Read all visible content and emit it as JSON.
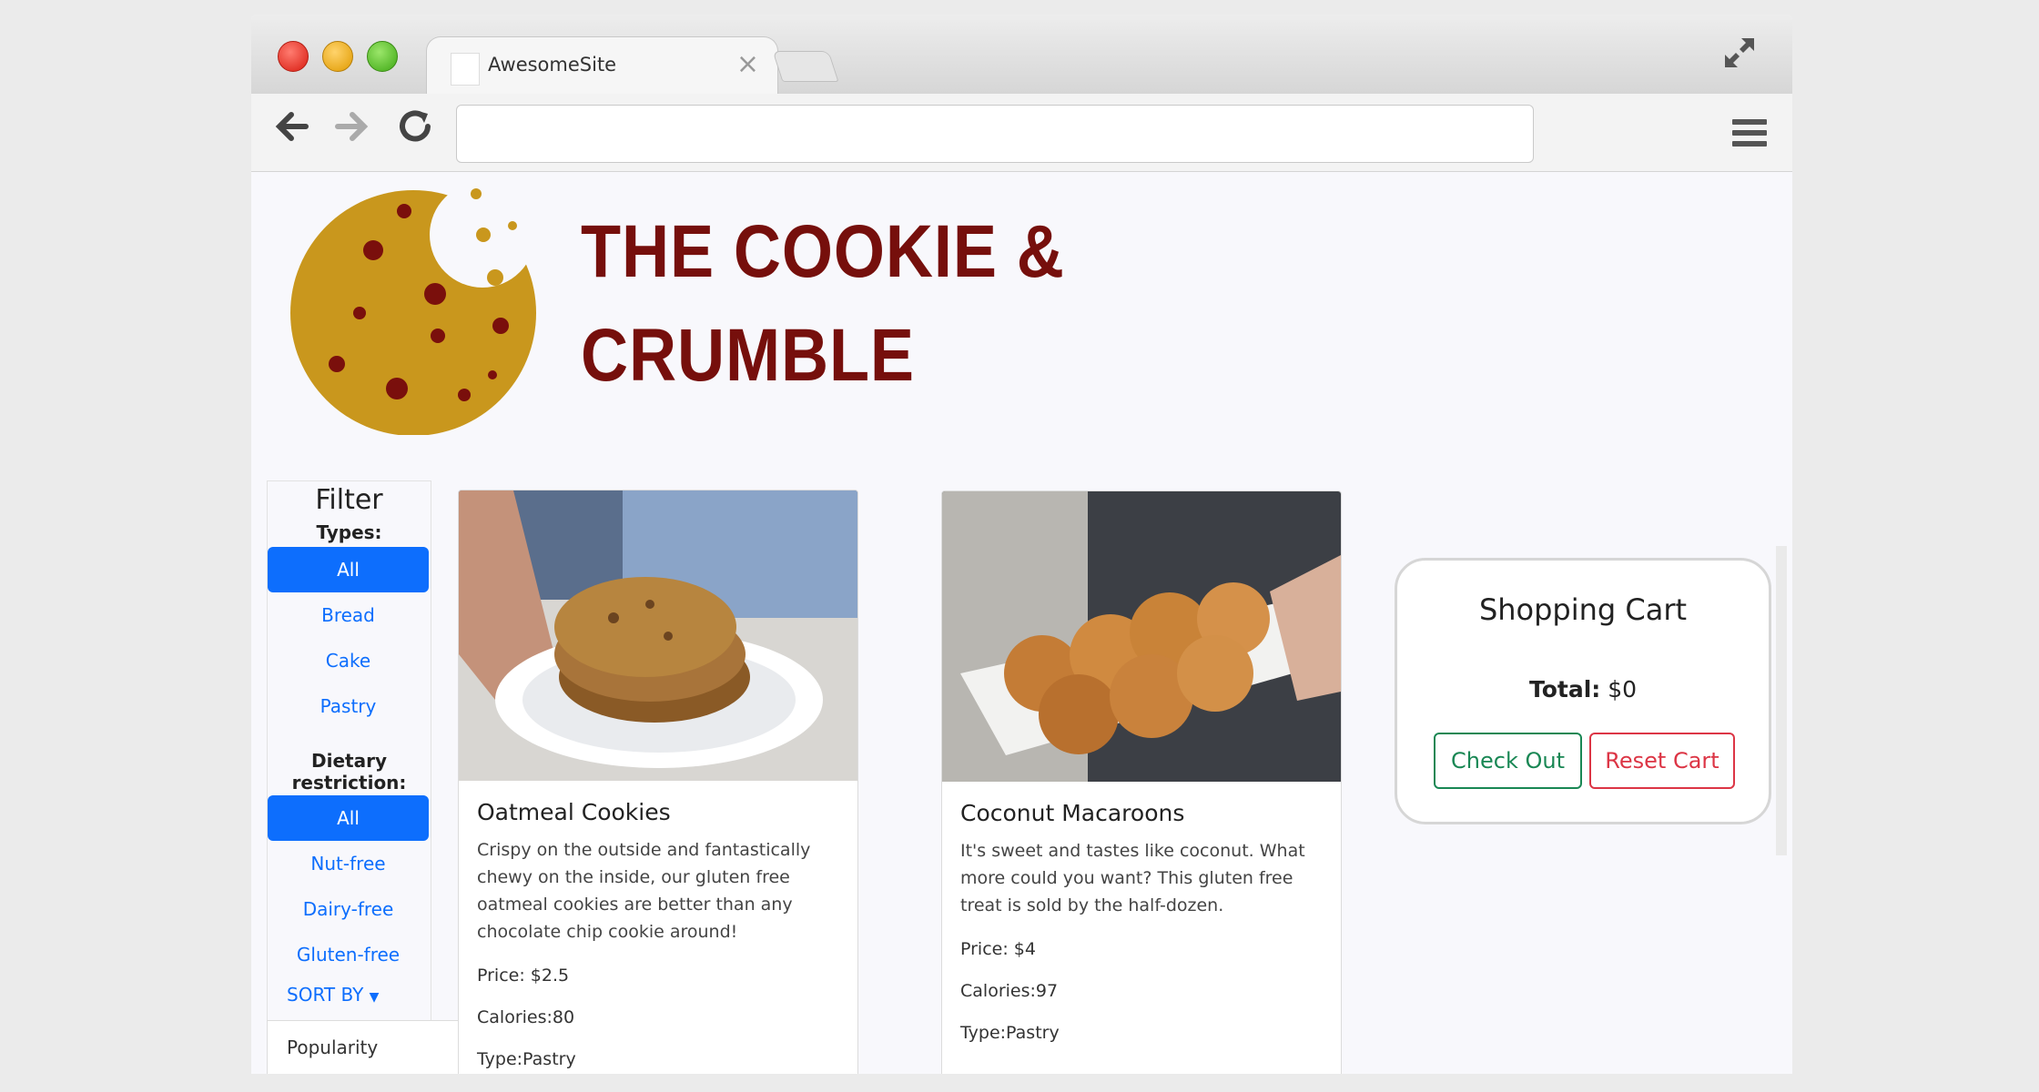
{
  "browser": {
    "tab_title": "AwesomeSite",
    "tab_close": "×",
    "url": ""
  },
  "brand": {
    "line1": "THE COOKIE &",
    "line2": "CRUMBLE"
  },
  "filter": {
    "title": "Filter",
    "types_label": "Types:",
    "types": [
      "All",
      "Bread",
      "Cake",
      "Pastry"
    ],
    "types_selected": "All",
    "dietary_label": "Dietary restriction:",
    "dietary": [
      "All",
      "Nut-free",
      "Dairy-free",
      "Gluten-free"
    ],
    "dietary_selected": "All",
    "sort_label": "SORT BY",
    "sort_option": "Popularity"
  },
  "products": [
    {
      "name": "Oatmeal Cookies",
      "description": "Crispy on the outside and fantastically chewy on the inside, our gluten free oatmeal cookies are better than any chocolate chip cookie around!",
      "price": "Price: $2.5",
      "calories": "Calories:80",
      "type": "Type:Pastry"
    },
    {
      "name": "Coconut Macaroons",
      "description": "It's sweet and tastes like coconut. What more could you want? This gluten free treat is sold by the half-dozen.",
      "price": "Price: $4",
      "calories": "Calories:97",
      "type": "Type:Pastry"
    }
  ],
  "cart": {
    "title": "Shopping Cart",
    "total_label": "Total:",
    "total_value": "$0",
    "checkout_label": "Check Out",
    "reset_label": "Reset Cart"
  },
  "colors": {
    "brand_red": "#760f0c",
    "cookie_gold": "#c9971d",
    "primary": "#0d6efd",
    "success": "#198754",
    "danger": "#dc3545"
  }
}
